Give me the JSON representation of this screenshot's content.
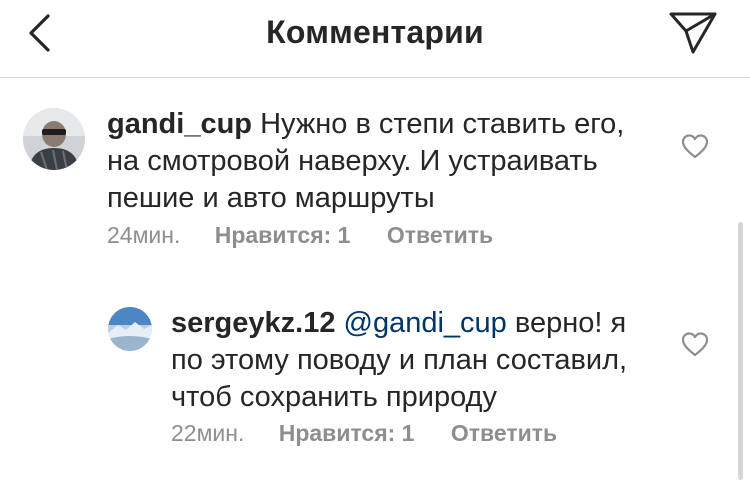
{
  "header": {
    "title": "Комментарии",
    "back_icon": "chevron-left-icon",
    "send_icon": "paper-plane-icon"
  },
  "comments": [
    {
      "username": "gandi_cup",
      "text_line1": "Нужно в степи ставить его,",
      "text_line2": "на смотровой  наверху. И устраивать",
      "text_line3": "пешие и авто маршруты",
      "time": "24мин.",
      "likes": "Нравится: 1",
      "reply": "Ответить"
    },
    {
      "username": "sergeykz.12",
      "mention": "@gandi_cup",
      "text_line1": "верно! я",
      "text_line2": "по этому поводу и план составил,",
      "text_line3": "чтоб сохранить природу",
      "time": "22мин.",
      "likes": "Нравится: 1",
      "reply": "Ответить"
    }
  ],
  "colors": {
    "text": "#262626",
    "meta": "#8e8e8e",
    "mention": "#003569",
    "divider": "#dbdbdb"
  }
}
